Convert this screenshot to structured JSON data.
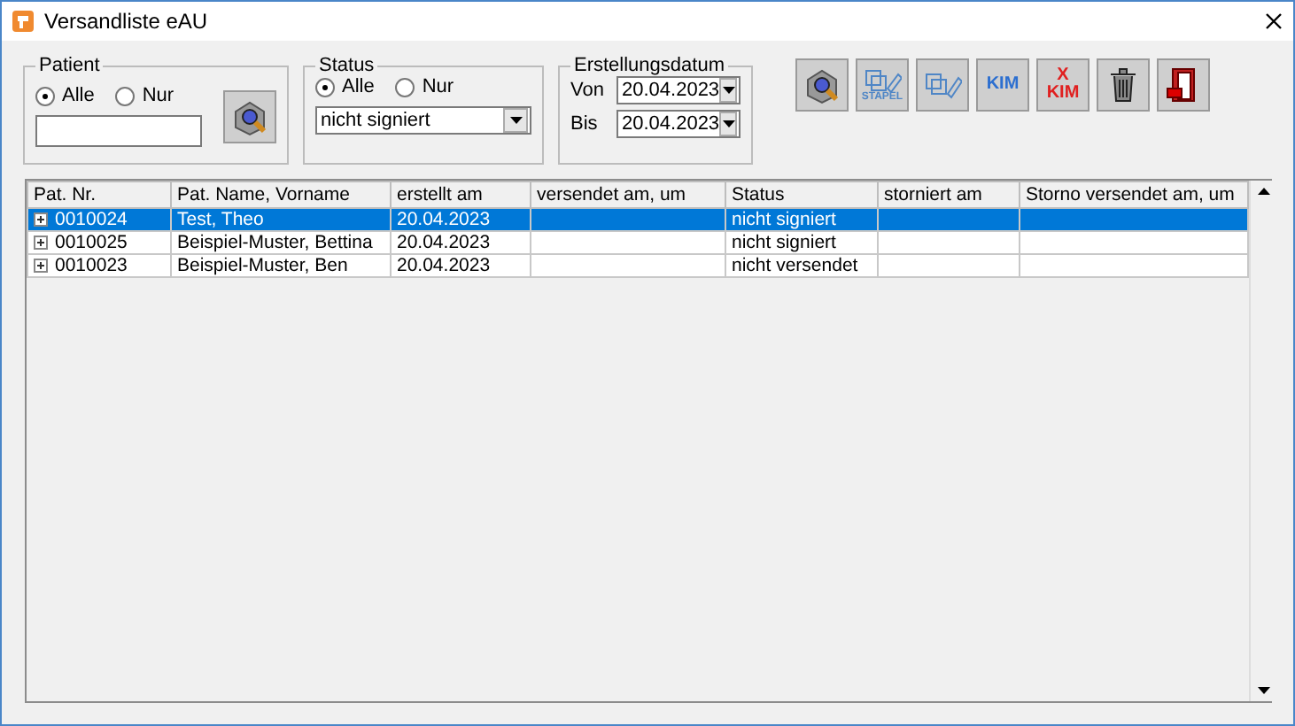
{
  "window": {
    "title": "Versandliste eAU"
  },
  "patient": {
    "legend": "Patient",
    "radios": [
      {
        "label": "Alle",
        "selected": true
      },
      {
        "label": "Nur",
        "selected": false
      }
    ]
  },
  "status": {
    "legend": "Status",
    "radios": [
      {
        "label": "Alle",
        "selected": true
      },
      {
        "label": "Nur",
        "selected": false
      }
    ],
    "value": "nicht signiert"
  },
  "date": {
    "legend": "Erstellungsdatum",
    "fields": [
      {
        "label": "Von",
        "value": "20.04.2023"
      },
      {
        "label": "Bis",
        "value": "20.04.2023"
      }
    ]
  },
  "toolbar": [
    {
      "kind": "search"
    },
    {
      "kind": "stack",
      "label": "STAPEL"
    },
    {
      "kind": "sign"
    },
    {
      "kind": "kim",
      "label": "KIM"
    },
    {
      "kind": "xkim",
      "mark": "X",
      "label": "KIM"
    },
    {
      "kind": "trash"
    },
    {
      "kind": "exit"
    }
  ],
  "table": {
    "columns": [
      "Pat. Nr.",
      "Pat. Name, Vorname",
      "erstellt am",
      "versendet am, um",
      "Status",
      "storniert am",
      "Storno versendet am, um"
    ],
    "rows": [
      {
        "selected": true,
        "cells": [
          "0010024",
          "Test, Theo",
          "20.04.2023",
          "",
          "nicht signiert",
          "",
          ""
        ]
      },
      {
        "selected": false,
        "cells": [
          "0010025",
          "Beispiel-Muster, Bettina",
          "20.04.2023",
          "",
          "nicht signiert",
          "",
          ""
        ]
      },
      {
        "selected": false,
        "cells": [
          "0010023",
          "Beispiel-Muster, Ben",
          "20.04.2023",
          "",
          "nicht versendet",
          "",
          ""
        ]
      }
    ]
  }
}
